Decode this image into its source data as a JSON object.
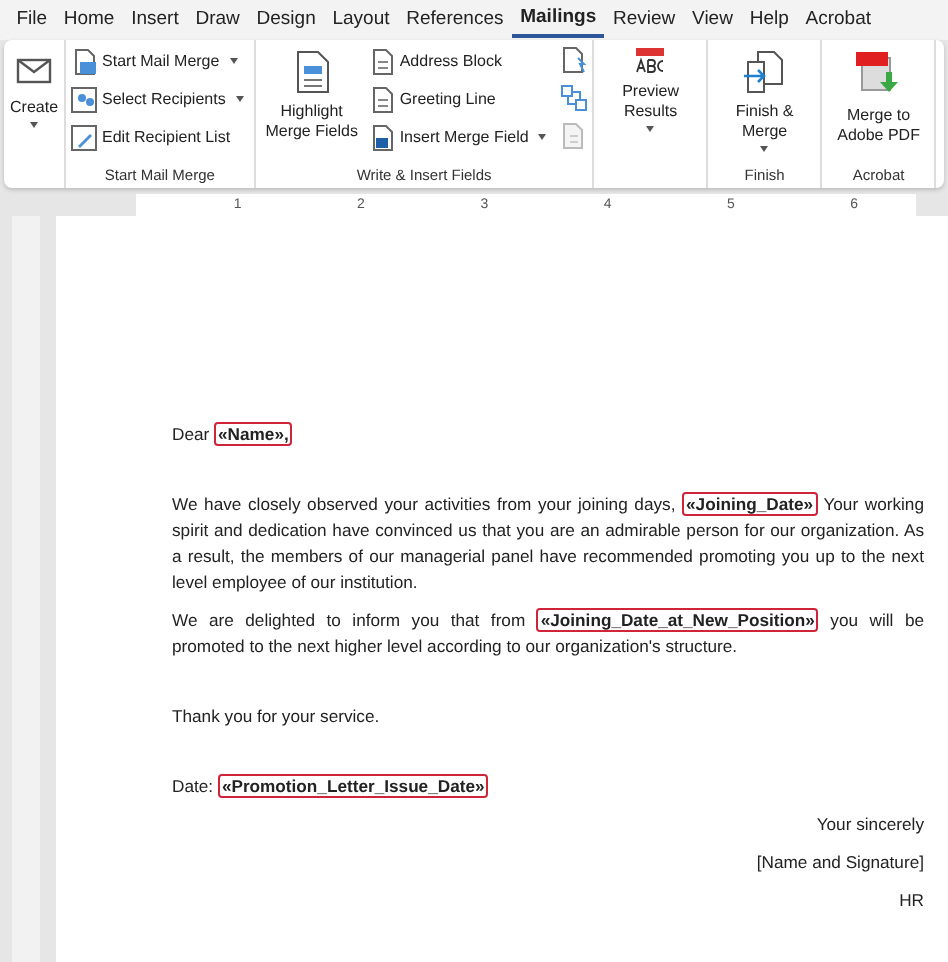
{
  "tabs": [
    {
      "label": "File",
      "selected": false
    },
    {
      "label": "Home",
      "selected": false
    },
    {
      "label": "Insert",
      "selected": false
    },
    {
      "label": "Draw",
      "selected": false
    },
    {
      "label": "Design",
      "selected": false
    },
    {
      "label": "Layout",
      "selected": false
    },
    {
      "label": "References",
      "selected": false
    },
    {
      "label": "Mailings",
      "selected": true
    },
    {
      "label": "Review",
      "selected": false
    },
    {
      "label": "View",
      "selected": false
    },
    {
      "label": "Help",
      "selected": false
    },
    {
      "label": "Acrobat",
      "selected": false
    }
  ],
  "ribbon": [
    {
      "items": [
        {
          "kind": "big",
          "label": "Create",
          "caret": true
        }
      ]
    },
    {
      "label": "Start Mail Merge",
      "items": [
        {
          "kind": "small",
          "label": "Start Mail Merge",
          "caret": true
        },
        {
          "kind": "small",
          "label": "Select Recipients",
          "caret": true
        },
        {
          "kind": "small",
          "label": "Edit Recipient List",
          "caret": false
        }
      ]
    },
    {
      "label": "Write & Insert Fields",
      "items": [
        {
          "kind": "big",
          "label": "Highlight Merge Fields",
          "caret": false
        },
        {
          "kind": "small",
          "label": "Address Block",
          "caret": false
        },
        {
          "kind": "small",
          "label": "Greeting Line",
          "caret": false
        },
        {
          "kind": "small",
          "label": "Insert Merge Field",
          "caret": true
        },
        {
          "kind": "icon-column"
        }
      ]
    },
    {
      "items": [
        {
          "kind": "big",
          "label": "Preview Results",
          "caret": true
        }
      ]
    },
    {
      "label": "Finish",
      "items": [
        {
          "kind": "big",
          "label": "Finish & Merge",
          "caret": true
        }
      ]
    },
    {
      "label": "Acrobat",
      "items": [
        {
          "kind": "big",
          "label": "Merge to Adobe PDF",
          "caret": false
        }
      ]
    }
  ],
  "ruler": {
    "marks": [
      "1",
      "2",
      "3",
      "4",
      "5",
      "6"
    ]
  },
  "letter": [
    {
      "kind": "greeting",
      "parts": [
        {
          "text": "Dear "
        },
        {
          "field": "«Name»,"
        }
      ]
    },
    {
      "kind": "body",
      "parts": [
        {
          "text": "We have closely observed your activities from your joining days, "
        },
        {
          "field": "«Joining_Date»"
        },
        {
          "text": " Your working spirit and dedication have convinced us that you are an admirable person for our organization. As a result, the members of our managerial panel have recommended promoting you up to the next level employee of our institution."
        }
      ]
    },
    {
      "kind": "body-end",
      "parts": [
        {
          "text": "We are delighted to inform you that from "
        },
        {
          "field": "«Joining_Date_at_New_Position»"
        },
        {
          "text": " you will be promoted to the next higher level according to our organization's structure."
        }
      ]
    },
    {
      "kind": "thanks",
      "parts": [
        {
          "text": "Thank you for your service."
        }
      ]
    },
    {
      "kind": "date",
      "parts": [
        {
          "text": "Date: "
        },
        {
          "field": "«Promotion_Letter_Issue_Date»"
        }
      ]
    },
    {
      "kind": "closing",
      "parts": [
        {
          "text": "Your sincerely"
        }
      ]
    },
    {
      "kind": "closing",
      "parts": [
        {
          "text": "[Name and Signature]"
        }
      ]
    },
    {
      "kind": "closing",
      "parts": [
        {
          "text": "HR"
        }
      ]
    }
  ]
}
